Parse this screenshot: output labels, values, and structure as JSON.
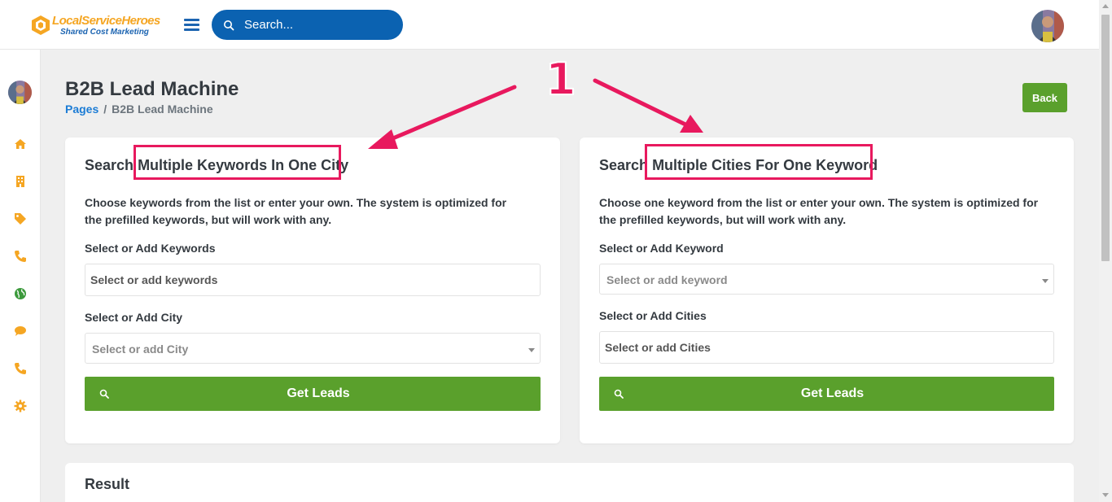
{
  "brand": {
    "name": "LocalServiceHeroes",
    "tagline": "Shared Cost Marketing",
    "accent_color": "#f5a623",
    "primary_color": "#0b62b1",
    "success_color": "#5aa02c"
  },
  "header": {
    "search_placeholder": "Search...",
    "menu_icon": "hamburger-icon",
    "search_icon": "search-icon"
  },
  "sidebar": {
    "items": [
      {
        "icon": "home-icon",
        "color": "#f5a623"
      },
      {
        "icon": "building-icon",
        "color": "#f5a623"
      },
      {
        "icon": "tag-icon",
        "color": "#f5a623"
      },
      {
        "icon": "phone-icon",
        "color": "#f5a623"
      },
      {
        "icon": "globe-icon",
        "color": "#3c9a3c"
      },
      {
        "icon": "chat-icon",
        "color": "#f5a623"
      },
      {
        "icon": "phone-icon",
        "color": "#f5a623"
      },
      {
        "icon": "gear-icon",
        "color": "#f5a623"
      }
    ]
  },
  "page": {
    "title": "B2B Lead Machine",
    "breadcrumb": [
      "Pages",
      "/",
      "B2B Lead Machine"
    ],
    "back_label": "Back"
  },
  "left_card": {
    "title_prefix": "Search",
    "title_highlight": "Multiple Keywords In One City",
    "description": "Choose keywords from the list or enter your own. The system is optimized for the prefilled keywords, but will work with any.",
    "keywords_label": "Select or Add Keywords",
    "keywords_placeholder": "Select or add keywords",
    "city_label": "Select or Add City",
    "city_placeholder": "Select or add City",
    "button_label": "Get Leads"
  },
  "right_card": {
    "title_prefix": "Search",
    "title_highlight": "Multiple Cities For One Keyword",
    "description": "Choose one keyword from the list or enter your own. The system is optimized for the prefilled keywords, but will work with any.",
    "keyword_label": "Select or Add Keyword",
    "keyword_placeholder": "Select or add keyword",
    "cities_label": "Select or Add Cities",
    "cities_placeholder": "Select or add Cities",
    "button_label": "Get Leads"
  },
  "result": {
    "title": "Result"
  },
  "annotation": {
    "step_number": "1",
    "color": "#e8195e"
  }
}
